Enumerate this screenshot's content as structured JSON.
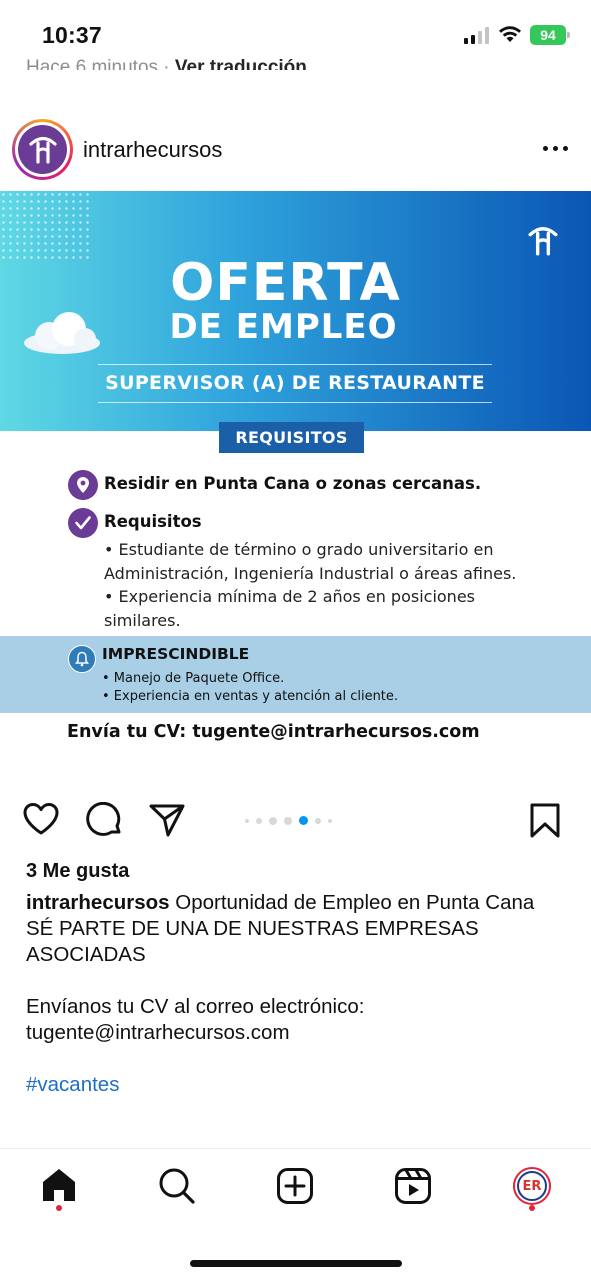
{
  "status_bar": {
    "time": "10:37",
    "battery": "94",
    "battery_color": "#34c759"
  },
  "above_post": {
    "time_ago": "Hace 6 minutos",
    "separator": "·",
    "translation_link": "Ver traducción"
  },
  "post": {
    "username": "intrarhecursos",
    "avatar_icon": "intrarhe-logo-icon",
    "more_icon": "ellipsis-icon"
  },
  "flyer": {
    "title_line1": "OFERTA",
    "title_line2": "DE EMPLEO",
    "position": "SUPERVISOR (A) DE RESTAURANTE",
    "section_tag": "REQUISITOS",
    "location_requirement": "Residir en Punta Cana o zonas cercanas.",
    "requirements_heading": "Requisitos",
    "requirements": [
      "• Estudiante de término o grado universitario en Administración, Ingeniería Industrial o áreas afines.",
      "• Experiencia mínima de 2 años en posiciones similares."
    ],
    "essential_heading": "IMPRESCINDIBLE",
    "essential_items": [
      "• Manejo de Paquete Office.",
      "• Experiencia en ventas y atención al cliente."
    ],
    "send_cv": "Envía tu CV: tugente@intrarhecursos.com",
    "colors": {
      "banner_start": "#5fd8e4",
      "banner_end": "#0a56b4",
      "purple_icon": "#6a3c96",
      "tag_blue": "#1a5fa8",
      "band_blue": "#a8cfe6"
    }
  },
  "actions": {
    "like_icon": "heart-icon",
    "comment_icon": "comment-icon",
    "share_icon": "send-icon",
    "save_icon": "bookmark-icon",
    "carousel_active_index": 4,
    "carousel_count": 7,
    "carousel_active_color": "#0095f6"
  },
  "caption": {
    "likes": "3 Me gusta",
    "username": "intrarhecursos",
    "text_line1": "Oportunidad de Empleo en Punta Cana",
    "text_line2": "SÉ PARTE DE UNA DE NUESTRAS EMPRESAS ASOCIADAS",
    "text_line3": "Envíanos tu CV al correo electrónico:",
    "text_line4": "tugente@intrarhecursos.com",
    "hashtag": "#vacantes"
  },
  "bottom_nav": {
    "items": [
      "home-icon",
      "search-icon",
      "create-icon",
      "reels-icon",
      "profile-avatar"
    ],
    "profile_initials": "ER"
  }
}
